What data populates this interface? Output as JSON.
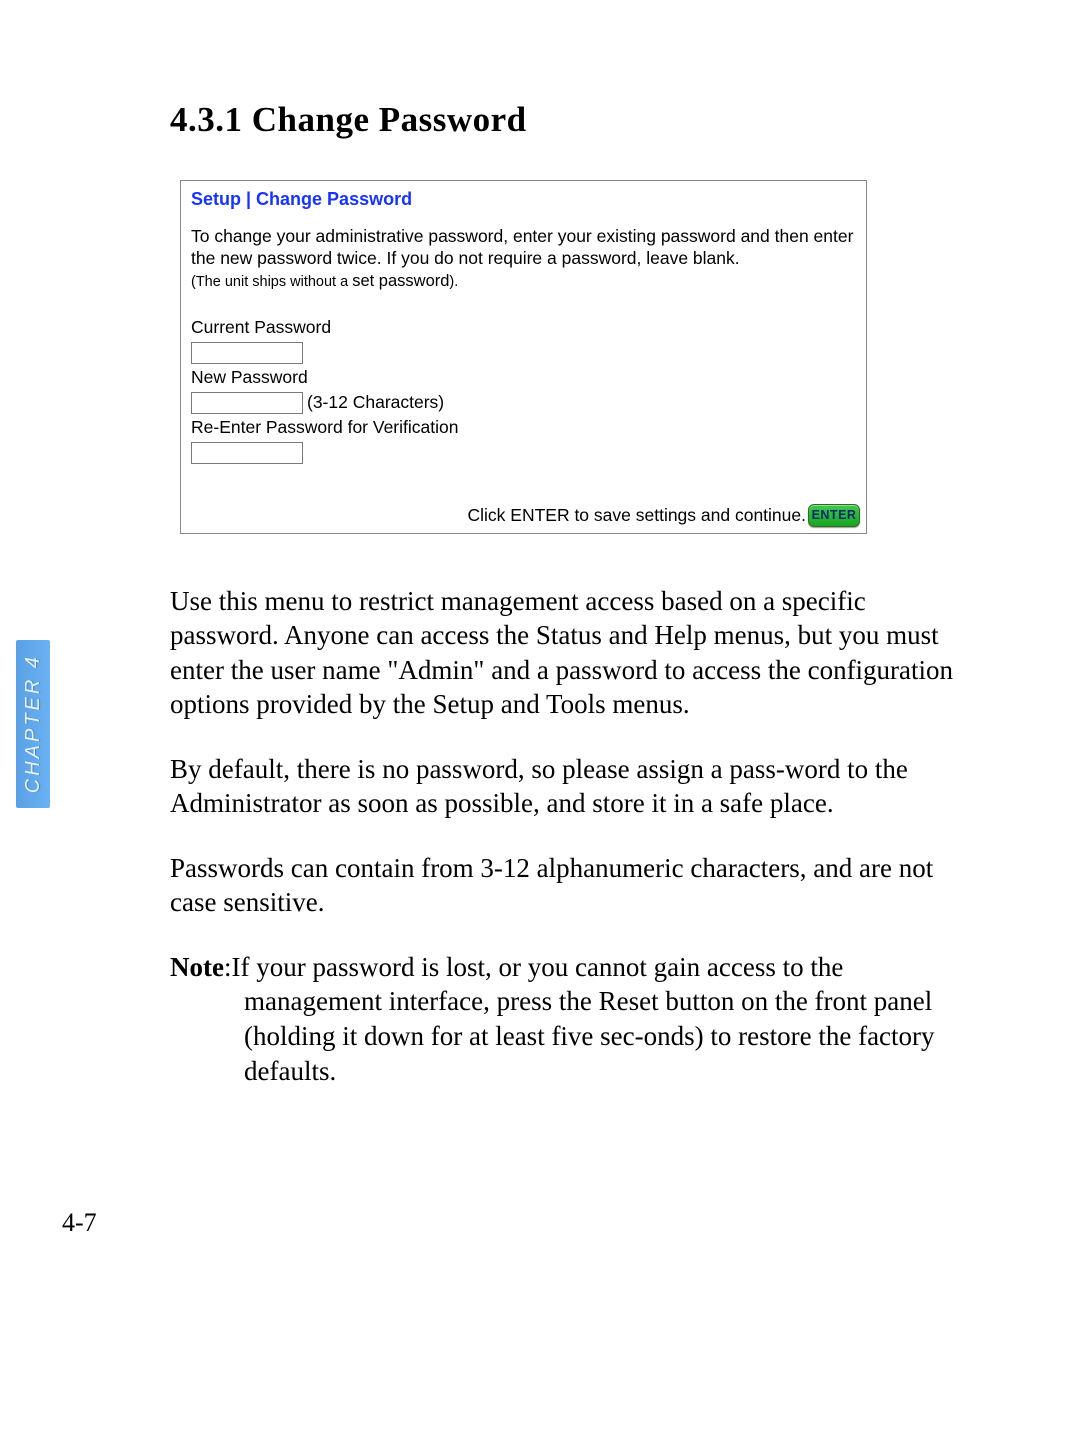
{
  "section": {
    "number": "4.3.1",
    "title": "Change Password"
  },
  "screenshot": {
    "breadcrumb": "Setup | Change Password",
    "description1": "To change your administrative password, enter your existing password and then enter the new password twice. If you do not require a password, leave blank.",
    "description2_pre": "(The unit ships without a ",
    "description2_code": "set password",
    "description2_post": ").",
    "labels": {
      "current": "Current Password",
      "new": "New Password",
      "new_hint": "(3-12 Characters)",
      "reenter": "Re-Enter Password for Verification"
    },
    "footer_text": "Click ENTER to save settings and continue.",
    "enter_button": "ENTER"
  },
  "body": {
    "p1": "Use this menu to restrict management access based on a specific password. Anyone can access the Status and Help menus, but you must enter the user name \"Admin\" and a password to access the configuration options provided by the Setup and Tools menus.",
    "p2": "By default, there is no password, so please assign a pass-word to the Administrator as soon as possible, and store it in a safe place.",
    "p3": "Passwords can contain from 3-12 alphanumeric characters, and are not case sensitive.",
    "note_label": "Note",
    "note_text": ":If your password is lost, or you cannot gain access to the management interface, press the Reset button on the front panel (holding it down for at least five sec-onds) to restore the factory defaults."
  },
  "sidebar": {
    "chapter_label": "CHAPTER 4"
  },
  "page_number": "4-7"
}
